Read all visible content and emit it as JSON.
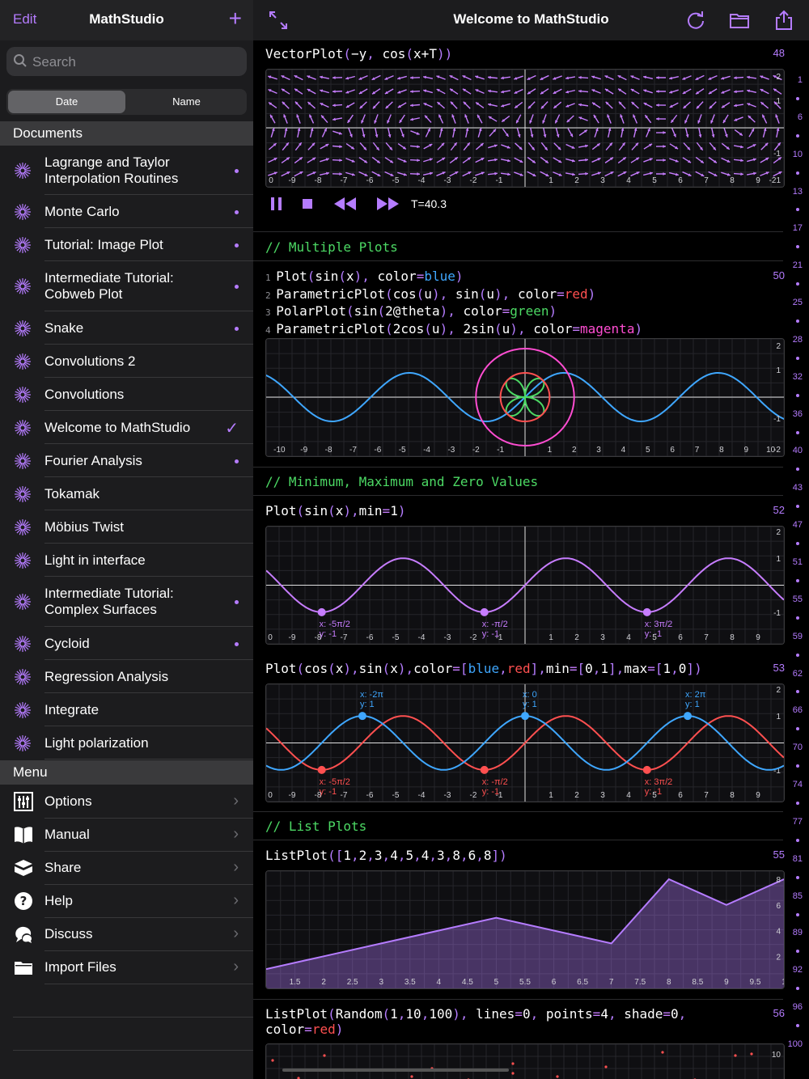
{
  "sidebar": {
    "edit_label": "Edit",
    "title": "MathStudio",
    "search_placeholder": "Search",
    "sort": {
      "date": "Date",
      "name": "Name"
    },
    "documents_header": "Documents",
    "documents": [
      {
        "label": "Lagrange and Taylor\nInterpolation Routines",
        "dot": true
      },
      {
        "label": "Monte Carlo",
        "dot": true
      },
      {
        "label": "Tutorial: Image Plot",
        "dot": true
      },
      {
        "label": "Intermediate Tutorial:\nCobweb Plot",
        "dot": true
      },
      {
        "label": "Snake",
        "dot": true
      },
      {
        "label": "Convolutions 2",
        "dot": false
      },
      {
        "label": "Convolutions",
        "dot": false
      },
      {
        "label": "Welcome to MathStudio",
        "check": true
      },
      {
        "label": "Fourier Analysis",
        "dot": true
      },
      {
        "label": "Tokamak",
        "dot": false
      },
      {
        "label": "Möbius Twist",
        "dot": false
      },
      {
        "label": "Light in interface",
        "dot": false
      },
      {
        "label": "Intermediate Tutorial:\nComplex Surfaces",
        "dot": true
      },
      {
        "label": "Cycloid",
        "dot": true
      },
      {
        "label": "Regression Analysis",
        "dot": false
      },
      {
        "label": "Integrate",
        "dot": false
      },
      {
        "label": "Light polarization",
        "dot": false
      }
    ],
    "menu_header": "Menu",
    "menu": [
      {
        "label": "Options",
        "icon": "sliders-icon"
      },
      {
        "label": "Manual",
        "icon": "book-icon"
      },
      {
        "label": "Share",
        "icon": "share-box-icon"
      },
      {
        "label": "Help",
        "icon": "help-icon"
      },
      {
        "label": "Discuss",
        "icon": "discuss-icon"
      },
      {
        "label": "Import Files",
        "icon": "folder-icon"
      }
    ]
  },
  "main": {
    "title": "Welcome to MathStudio",
    "cells": {
      "vector": {
        "code": "VectorPlot(−y, cos(x+T))",
        "num": "48",
        "time": "T=40.3"
      },
      "comment1": "// Multiple Plots",
      "multi": {
        "num": "50",
        "lines": [
          "Plot(sin(x), color=blue)",
          "ParametricPlot(cos(u), sin(u), color=red)",
          "PolarPlot(sin(2@theta), color=green)",
          "ParametricPlot(2cos(u), 2sin(u), color=magenta)"
        ]
      },
      "comment2": "// Minimum, Maximum and Zero Values",
      "sinmin": {
        "code": "Plot(sin(x),min=1)",
        "num": "52"
      },
      "cossin": {
        "code": "Plot(cos(x),sin(x),color=[blue,red],min=[0,1],max=[1,0])",
        "num": "53"
      },
      "comment3": "// List Plots",
      "list": {
        "code": "ListPlot([1,2,3,4,5,4,3,8,6,8])",
        "num": "55"
      },
      "random": {
        "code1": "ListPlot(Random(1,10,100), lines=0, points=4, shade=0,",
        "code2": "color=red)",
        "num": "56"
      }
    },
    "scroll_numbers": [
      "1",
      "6",
      "10",
      "13",
      "17",
      "21",
      "25",
      "28",
      "32",
      "36",
      "40",
      "43",
      "47",
      "51",
      "55",
      "59",
      "62",
      "66",
      "70",
      "74",
      "77",
      "81",
      "85",
      "89",
      "92",
      "96",
      "100"
    ]
  },
  "chart_data": [
    {
      "type": "line",
      "title": "Plot(sin(x),min=1)",
      "xlim": [
        -10,
        10
      ],
      "ylim": [
        -2,
        2
      ],
      "x_ticks": [
        -9,
        -8,
        -7,
        -6,
        -5,
        -4,
        -3,
        -2,
        -1,
        0,
        1,
        2,
        3,
        4,
        5,
        6,
        7,
        8,
        9
      ],
      "series": [
        {
          "name": "sin(x)",
          "color": "#c77dff",
          "function": "sin(x)"
        }
      ],
      "annotations": [
        {
          "x": "-5π/2",
          "y": "-1"
        },
        {
          "x": "-π/2",
          "y": "-1"
        },
        {
          "x": "3π/2",
          "y": "-1"
        }
      ]
    },
    {
      "type": "line",
      "title": "Plot(cos(x),sin(x),color=[blue,red],min=[0,1],max=[1,0])",
      "xlim": [
        -10,
        10
      ],
      "ylim": [
        -2,
        2
      ],
      "series": [
        {
          "name": "cos(x)",
          "color": "#3fa7ff",
          "function": "cos(x)"
        },
        {
          "name": "sin(x)",
          "color": "#ff5050",
          "function": "sin(x)"
        }
      ],
      "annotations": [
        {
          "x": "-2π",
          "y": "1"
        },
        {
          "x": "0",
          "y": "1"
        },
        {
          "x": "2π",
          "y": "1"
        },
        {
          "x": "-5π/2",
          "y": "-1"
        },
        {
          "x": "-π/2",
          "y": "-1"
        },
        {
          "x": "3π/2",
          "y": "-1"
        }
      ]
    },
    {
      "type": "area",
      "title": "ListPlot([1,2,3,4,5,4,3,8,6,8])",
      "x": [
        1,
        2,
        3,
        4,
        5,
        6,
        7,
        8,
        9,
        10
      ],
      "values": [
        1,
        2,
        3,
        4,
        5,
        4,
        3,
        8,
        6,
        8
      ],
      "x_tick_labels": [
        "1.5",
        "2",
        "2.5",
        "3",
        "3.5",
        "4",
        "4.5",
        "5",
        "5.5",
        "6",
        "6.5",
        "7",
        "7.5",
        "8",
        "8.5",
        "9",
        "9.5",
        "1"
      ],
      "ylim": [
        0,
        8
      ],
      "color": "#b57cff"
    }
  ]
}
